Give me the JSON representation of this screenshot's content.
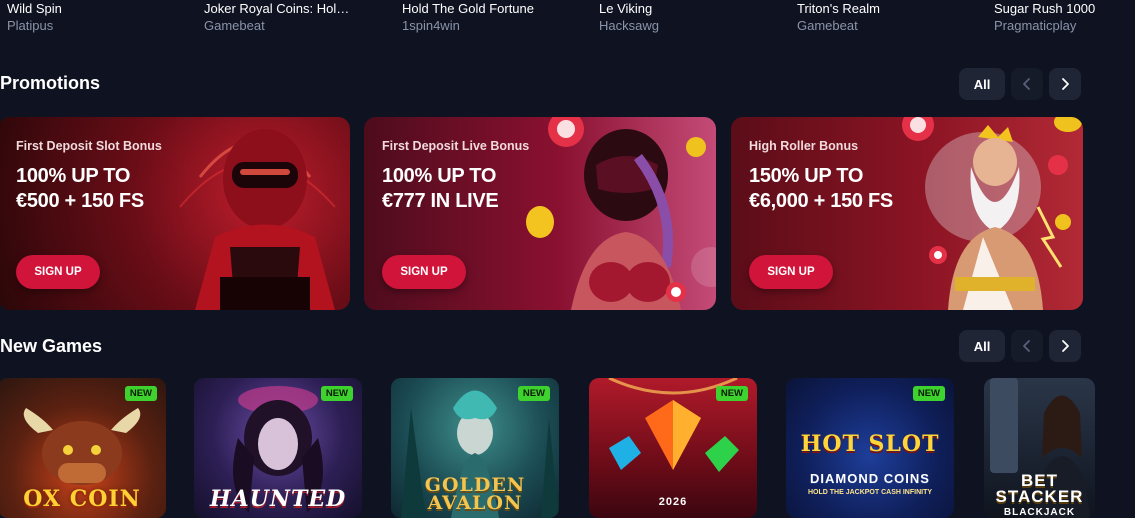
{
  "games_top": [
    {
      "title": "Wild Spin",
      "provider": "Platipus"
    },
    {
      "title": "Joker Royal Coins: Hold...",
      "provider": "Gamebeat"
    },
    {
      "title": "Hold The Gold Fortune",
      "provider": "1spin4win"
    },
    {
      "title": "Le Viking",
      "provider": "Hacksawg"
    },
    {
      "title": "Triton's Realm",
      "provider": "Gamebeat"
    },
    {
      "title": "Sugar Rush 1000",
      "provider": "Pragmaticplay"
    }
  ],
  "promotions": {
    "title": "Promotions",
    "all_label": "All",
    "cards": [
      {
        "label": "First Deposit Slot Bonus",
        "headline": "100% UP TO\n€500 + 150 FS",
        "button": "SIGN UP"
      },
      {
        "label": "First Deposit Live Bonus",
        "headline": "100% UP TO\n€777 IN LIVE",
        "button": "SIGN UP"
      },
      {
        "label": "High Roller Bonus",
        "headline": "150% UP TO\n€6,000 + 150 FS",
        "button": "SIGN UP"
      }
    ]
  },
  "new_games": {
    "title": "New Games",
    "all_label": "All",
    "badge": "NEW",
    "games": [
      {
        "title": "OX COIN"
      },
      {
        "title": "HAUNTED"
      },
      {
        "title": "GOLDEN AVALON"
      },
      {
        "title": "2026"
      },
      {
        "title": "HOT SLOT",
        "subtitle": "DIAMOND COINS",
        "tagline": "HOLD THE JACKPOT CASH INFINITY"
      },
      {
        "title": "BET STACKER",
        "subtitle": "BLACKJACK"
      }
    ]
  }
}
